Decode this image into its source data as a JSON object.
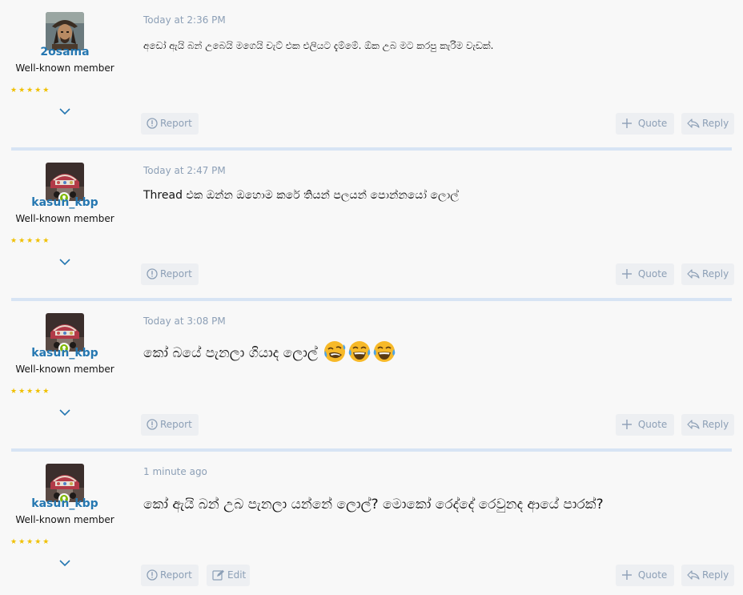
{
  "posts": [
    {
      "username": "2osama",
      "user_title": "Well-known member",
      "stars": "★★★★★",
      "avatar": "pirate-avatar",
      "online": false,
      "time": "Today at 2:36 PM",
      "message": "අඩෝ ඇයි බන් උබෙයි මගෙයි චැට් එක එලියට දැම්මේ. ඕක උබ මට කරපු කැරිම වැඩක්.",
      "emojis": [],
      "buttons": {
        "report": "Report",
        "quote": "Quote",
        "reply": "Reply"
      }
    },
    {
      "username": "kasun_kbp",
      "user_title": "Well-known member",
      "stars": "★★★★★",
      "avatar": "vehicle-avatar",
      "online": true,
      "time": "Today at 2:47 PM",
      "message": "Thread එක ඔන්න ඔහොම කරේ තියන් පලයන් පොන්නයෝ ලොල්",
      "emojis": [],
      "buttons": {
        "report": "Report",
        "quote": "Quote",
        "reply": "Reply"
      }
    },
    {
      "username": "kasun_kbp",
      "user_title": "Well-known member",
      "stars": "★★★★★",
      "avatar": "vehicle-avatar",
      "online": true,
      "time": "Today at 3:08 PM",
      "message": "කෝ බයේ පැනලා ගියාද ලොල්",
      "emojis": [
        "rofl-emoji",
        "joy-emoji",
        "joy-emoji"
      ],
      "buttons": {
        "report": "Report",
        "quote": "Quote",
        "reply": "Reply"
      }
    },
    {
      "username": "kasun_kbp",
      "user_title": "Well-known member",
      "stars": "★★★★★",
      "avatar": "vehicle-avatar",
      "online": true,
      "time": "1 minute ago",
      "message": "කෝ ඇයි බන් උබ පැනලා යන්නේ ලොල්? මොකෝ රෙද්දේ රෙවුනද ආයේ පාරක්?",
      "emojis": [],
      "buttons": {
        "report": "Report",
        "edit": "Edit",
        "quote": "Quote",
        "reply": "Reply"
      }
    }
  ],
  "colors": {
    "username": "#2577b1",
    "meta": "#8c9fb6",
    "separator": "#d7e4f4",
    "button_bg": "#edeff2",
    "star": "#f0c000",
    "online": "#7fb900"
  }
}
